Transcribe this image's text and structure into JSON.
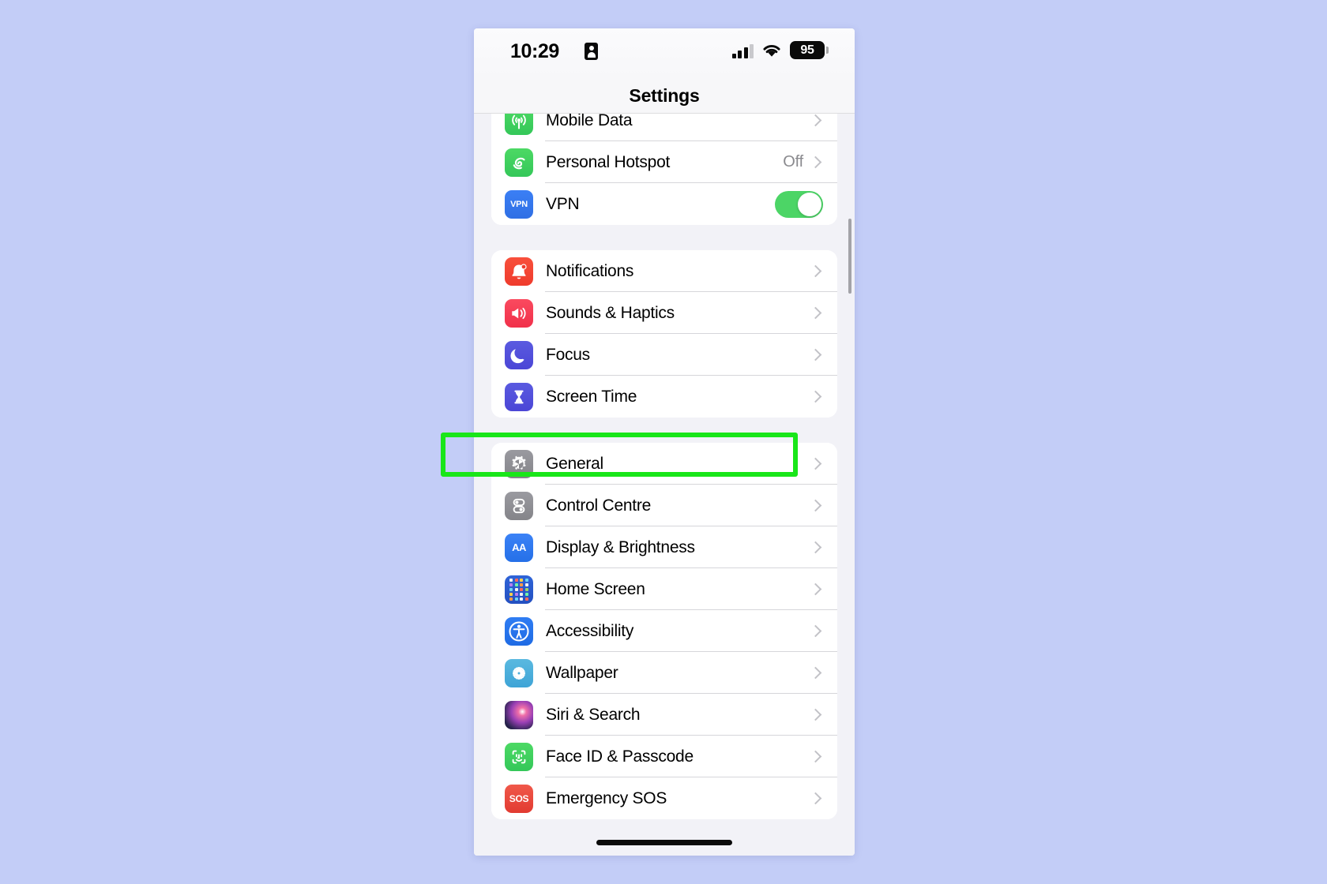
{
  "status_bar": {
    "time": "10:29",
    "recording_icon": "person-badge-icon",
    "cellular_icon": "cellular-bars-icon",
    "wifi_icon": "wifi-icon",
    "battery_percent": "95"
  },
  "nav": {
    "title": "Settings"
  },
  "highlight": {
    "color": "#19e619",
    "target": "General"
  },
  "groups": [
    {
      "id": "connectivity",
      "clipped_top": true,
      "rows": [
        {
          "label": "Mobile Data",
          "icon": "mobile-data-icon",
          "value": "",
          "accessory": "chevron"
        },
        {
          "label": "Personal Hotspot",
          "icon": "personal-hotspot-icon",
          "value": "Off",
          "accessory": "chevron"
        },
        {
          "label": "VPN",
          "icon": "vpn-icon",
          "value": "",
          "accessory": "toggle",
          "toggle_on": true
        }
      ]
    },
    {
      "id": "alerts",
      "clipped_top": false,
      "rows": [
        {
          "label": "Notifications",
          "icon": "notifications-icon",
          "value": "",
          "accessory": "chevron"
        },
        {
          "label": "Sounds & Haptics",
          "icon": "sounds-haptics-icon",
          "value": "",
          "accessory": "chevron"
        },
        {
          "label": "Focus",
          "icon": "focus-icon",
          "value": "",
          "accessory": "chevron"
        },
        {
          "label": "Screen Time",
          "icon": "screen-time-icon",
          "value": "",
          "accessory": "chevron"
        }
      ]
    },
    {
      "id": "system",
      "clipped_top": false,
      "rows": [
        {
          "label": "General",
          "icon": "general-gear-icon",
          "value": "",
          "accessory": "chevron"
        },
        {
          "label": "Control Centre",
          "icon": "control-centre-icon",
          "value": "",
          "accessory": "chevron"
        },
        {
          "label": "Display & Brightness",
          "icon": "display-brightness-icon",
          "value": "",
          "accessory": "chevron"
        },
        {
          "label": "Home Screen",
          "icon": "home-screen-icon",
          "value": "",
          "accessory": "chevron"
        },
        {
          "label": "Accessibility",
          "icon": "accessibility-icon",
          "value": "",
          "accessory": "chevron"
        },
        {
          "label": "Wallpaper",
          "icon": "wallpaper-icon",
          "value": "",
          "accessory": "chevron"
        },
        {
          "label": "Siri & Search",
          "icon": "siri-search-icon",
          "value": "",
          "accessory": "chevron"
        },
        {
          "label": "Face ID & Passcode",
          "icon": "face-id-passcode-icon",
          "value": "",
          "accessory": "chevron"
        },
        {
          "label": "Emergency SOS",
          "icon": "emergency-sos-icon",
          "value": "",
          "accessory": "chevron"
        }
      ]
    }
  ],
  "icon_glyph_text": {
    "vpn": "VPN",
    "display": "AA",
    "sos": "SOS"
  }
}
